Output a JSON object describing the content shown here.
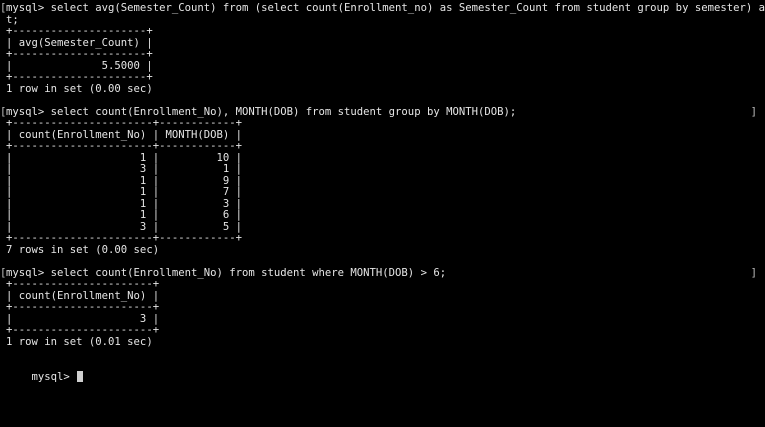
{
  "terminal": {
    "lines": [
      {
        "text": "mysql> select avg(Semester_Count) from (select count(Enrollment_no) as Semester_Count from student group by semester) as Coun",
        "left_bracket": true,
        "right_bracket": false
      },
      {
        "text": "t;",
        "left_bracket": false,
        "right_bracket": false
      },
      {
        "text": "+---------------------+",
        "left_bracket": false,
        "right_bracket": false
      },
      {
        "text": "| avg(Semester_Count) |",
        "left_bracket": false,
        "right_bracket": false
      },
      {
        "text": "+---------------------+",
        "left_bracket": false,
        "right_bracket": false
      },
      {
        "text": "|              5.5000 |",
        "left_bracket": false,
        "right_bracket": false
      },
      {
        "text": "+---------------------+",
        "left_bracket": false,
        "right_bracket": false
      },
      {
        "text": "1 row in set (0.00 sec)",
        "left_bracket": false,
        "right_bracket": false
      },
      {
        "text": "",
        "left_bracket": false,
        "right_bracket": false
      },
      {
        "text": "mysql> select count(Enrollment_No), MONTH(DOB) from student group by MONTH(DOB);",
        "left_bracket": true,
        "right_bracket": true
      },
      {
        "text": "+----------------------+------------+",
        "left_bracket": false,
        "right_bracket": false
      },
      {
        "text": "| count(Enrollment_No) | MONTH(DOB) |",
        "left_bracket": false,
        "right_bracket": false
      },
      {
        "text": "+----------------------+------------+",
        "left_bracket": false,
        "right_bracket": false
      },
      {
        "text": "|                    1 |         10 |",
        "left_bracket": false,
        "right_bracket": false
      },
      {
        "text": "|                    3 |          1 |",
        "left_bracket": false,
        "right_bracket": false
      },
      {
        "text": "|                    1 |          9 |",
        "left_bracket": false,
        "right_bracket": false
      },
      {
        "text": "|                    1 |          7 |",
        "left_bracket": false,
        "right_bracket": false
      },
      {
        "text": "|                    1 |          3 |",
        "left_bracket": false,
        "right_bracket": false
      },
      {
        "text": "|                    1 |          6 |",
        "left_bracket": false,
        "right_bracket": false
      },
      {
        "text": "|                    3 |          5 |",
        "left_bracket": false,
        "right_bracket": false
      },
      {
        "text": "+----------------------+------------+",
        "left_bracket": false,
        "right_bracket": false
      },
      {
        "text": "7 rows in set (0.00 sec)",
        "left_bracket": false,
        "right_bracket": false
      },
      {
        "text": "",
        "left_bracket": false,
        "right_bracket": false
      },
      {
        "text": "mysql> select count(Enrollment_No) from student where MONTH(DOB) > 6;",
        "left_bracket": true,
        "right_bracket": true
      },
      {
        "text": "+----------------------+",
        "left_bracket": false,
        "right_bracket": false
      },
      {
        "text": "| count(Enrollment_No) |",
        "left_bracket": false,
        "right_bracket": false
      },
      {
        "text": "+----------------------+",
        "left_bracket": false,
        "right_bracket": false
      },
      {
        "text": "|                    3 |",
        "left_bracket": false,
        "right_bracket": false
      },
      {
        "text": "+----------------------+",
        "left_bracket": false,
        "right_bracket": false
      },
      {
        "text": "1 row in set (0.01 sec)",
        "left_bracket": false,
        "right_bracket": false
      },
      {
        "text": "",
        "left_bracket": false,
        "right_bracket": false
      }
    ],
    "prompt": "mysql> ",
    "cursor_icon": "block-cursor-icon",
    "colors": {
      "background": "#000000",
      "foreground": "#e6e6e6",
      "cursor": "#cfcfcf"
    }
  }
}
